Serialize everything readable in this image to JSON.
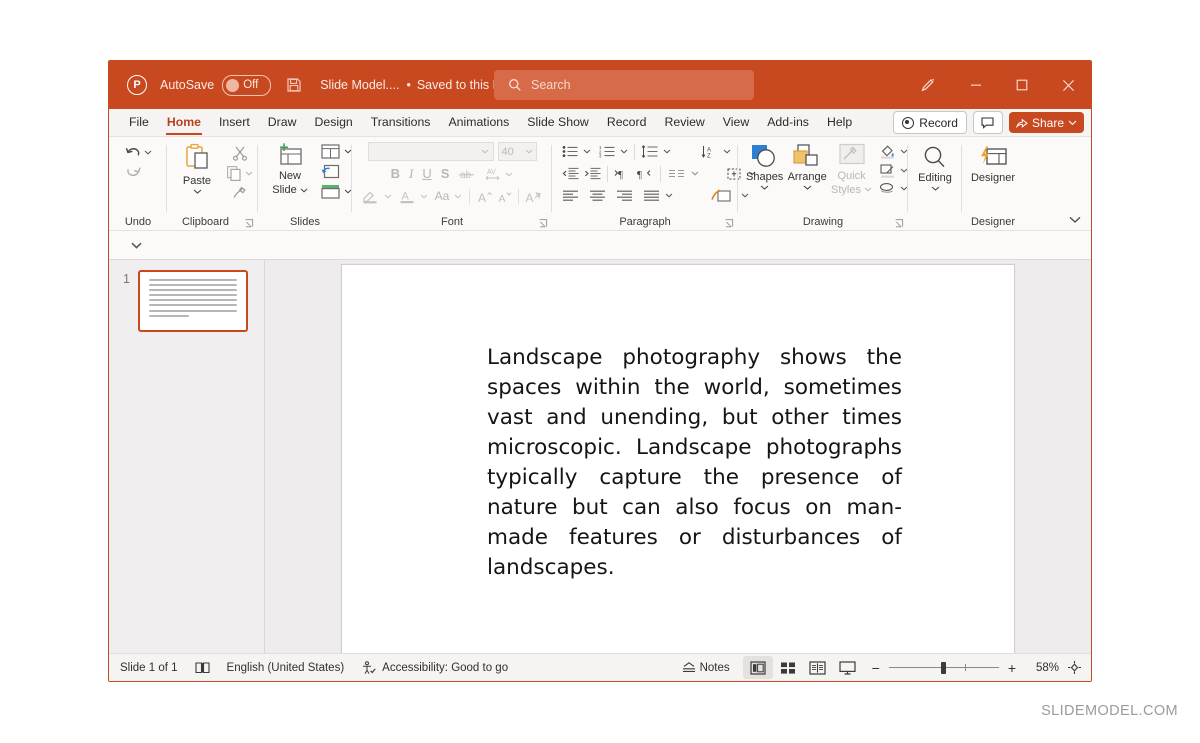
{
  "titlebar": {
    "app_icon": "powerpoint-logo-icon",
    "autosave_label": "AutoSave",
    "autosave_state": "Off",
    "save_icon": "save-icon",
    "document_name": "Slide Model....",
    "separator": "•",
    "save_status": "Saved to this PC",
    "search_placeholder": "Search",
    "search_icon": "search-icon",
    "pen_icon": "pen-icon",
    "minimize_icon": "minimize-icon",
    "maximize_icon": "maximize-icon",
    "close_icon": "close-icon",
    "bg_color": "#c8481f"
  },
  "tabs": [
    {
      "label": "File",
      "active": false
    },
    {
      "label": "Home",
      "active": true
    },
    {
      "label": "Insert",
      "active": false
    },
    {
      "label": "Draw",
      "active": false
    },
    {
      "label": "Design",
      "active": false
    },
    {
      "label": "Transitions",
      "active": false
    },
    {
      "label": "Animations",
      "active": false
    },
    {
      "label": "Slide Show",
      "active": false
    },
    {
      "label": "Record",
      "active": false
    },
    {
      "label": "Review",
      "active": false
    },
    {
      "label": "View",
      "active": false
    },
    {
      "label": "Add-ins",
      "active": false
    },
    {
      "label": "Help",
      "active": false
    }
  ],
  "tab_actions": {
    "record_label": "Record",
    "comment_icon": "comment-icon",
    "share_label": "Share",
    "share_icon": "share-icon",
    "share_chevron": "⌄"
  },
  "ribbon": {
    "groups": [
      {
        "name": "Undo",
        "label": "Undo",
        "items": [
          {
            "name": "undo-button",
            "icon": "undo-arrow-icon",
            "label": ""
          },
          {
            "name": "redo-button",
            "icon": "redo-arrow-icon",
            "label": ""
          }
        ]
      },
      {
        "name": "Clipboard",
        "label": "Clipboard",
        "items": [
          {
            "name": "paste-button",
            "icon": "clipboard-icon",
            "label": "Paste"
          },
          {
            "name": "cut-button",
            "icon": "scissors-icon",
            "label": ""
          },
          {
            "name": "copy-button",
            "icon": "copy-icon",
            "label": ""
          },
          {
            "name": "format-painter-button",
            "icon": "paintbrush-icon",
            "label": ""
          }
        ],
        "dialog_launcher": true
      },
      {
        "name": "Slides",
        "label": "Slides",
        "items": [
          {
            "name": "new-slide-button",
            "icon": "new-slide-icon",
            "label": "New Slide"
          },
          {
            "name": "layout-button",
            "icon": "layout-icon",
            "label": ""
          },
          {
            "name": "reset-button",
            "icon": "reset-icon",
            "label": ""
          },
          {
            "name": "section-button",
            "icon": "section-icon",
            "label": ""
          }
        ]
      },
      {
        "name": "Font",
        "label": "Font",
        "disabled": true,
        "font_name_value": "",
        "font_size_value": "40",
        "items": [
          {
            "name": "bold-button",
            "icon": "bold-icon",
            "label": "B"
          },
          {
            "name": "italic-button",
            "icon": "italic-icon",
            "label": "I"
          },
          {
            "name": "underline-button",
            "icon": "underline-icon",
            "label": "U"
          },
          {
            "name": "shadow-button",
            "icon": "text-shadow-icon",
            "label": "S"
          },
          {
            "name": "strikethrough-button",
            "icon": "strikethrough-icon",
            "label": "ab"
          },
          {
            "name": "character-spacing-button",
            "icon": "character-spacing-icon",
            "label": "AV"
          },
          {
            "name": "text-highlight-button",
            "icon": "highlighter-icon",
            "label": ""
          },
          {
            "name": "font-color-button",
            "icon": "font-color-icon",
            "label": "A"
          },
          {
            "name": "change-case-button",
            "icon": "change-case-icon",
            "label": "Aa"
          },
          {
            "name": "increase-font-size-button",
            "icon": "increase-font-icon",
            "label": "A"
          },
          {
            "name": "decrease-font-size-button",
            "icon": "decrease-font-icon",
            "label": "A"
          },
          {
            "name": "clear-formatting-button",
            "icon": "clear-formatting-icon",
            "label": "A"
          }
        ],
        "dialog_launcher": true
      },
      {
        "name": "Paragraph",
        "label": "Paragraph",
        "items": [
          {
            "name": "bullets-button",
            "icon": "bullet-list-icon"
          },
          {
            "name": "numbering-button",
            "icon": "numbered-list-icon"
          },
          {
            "name": "line-spacing-button",
            "icon": "line-spacing-icon"
          },
          {
            "name": "text-direction-button",
            "icon": "text-direction-icon"
          },
          {
            "name": "decrease-indent-button",
            "icon": "decrease-indent-icon"
          },
          {
            "name": "increase-indent-button",
            "icon": "increase-indent-icon"
          },
          {
            "name": "ltr-button",
            "icon": "left-to-right-icon"
          },
          {
            "name": "rtl-button",
            "icon": "right-to-left-icon"
          },
          {
            "name": "columns-button",
            "icon": "columns-icon"
          },
          {
            "name": "align-text-button",
            "icon": "align-text-icon"
          },
          {
            "name": "align-left-button",
            "icon": "align-left-icon"
          },
          {
            "name": "align-center-button",
            "icon": "align-center-icon"
          },
          {
            "name": "align-right-button",
            "icon": "align-right-icon"
          },
          {
            "name": "justify-button",
            "icon": "justify-icon"
          },
          {
            "name": "convert-smartart-button",
            "icon": "smartart-icon"
          }
        ],
        "dialog_launcher": true
      },
      {
        "name": "Drawing",
        "label": "Drawing",
        "items": [
          {
            "name": "shapes-button",
            "icon": "shapes-icon",
            "label": "Shapes"
          },
          {
            "name": "arrange-button",
            "icon": "arrange-icon",
            "label": "Arrange"
          },
          {
            "name": "quick-styles-button",
            "icon": "quick-styles-icon",
            "label": "Quick Styles",
            "disabled": true
          },
          {
            "name": "shape-fill-button",
            "icon": "fill-bucket-icon",
            "label": ""
          },
          {
            "name": "shape-outline-button",
            "icon": "shape-outline-icon",
            "label": ""
          },
          {
            "name": "shape-effects-button",
            "icon": "shape-effects-icon",
            "label": ""
          }
        ],
        "dialog_launcher": true
      },
      {
        "name": "Editing",
        "label": "",
        "items": [
          {
            "name": "editing-button",
            "icon": "magnifier-icon",
            "label": "Editing"
          }
        ]
      },
      {
        "name": "Designer",
        "label": "Designer",
        "items": [
          {
            "name": "designer-button",
            "icon": "designer-icon",
            "label": "Designer"
          }
        ]
      }
    ],
    "collapse_icon": "ribbon-collapse-chevron-icon"
  },
  "subbar": {
    "dropdown_icon": "chevron-down-icon"
  },
  "thumbnails": {
    "slides": [
      {
        "number": "1",
        "selected": true,
        "text_line_count": 8
      }
    ]
  },
  "slide": {
    "body_text": "Landscape photography shows the spaces within the world, sometimes vast and unending, but other times microscopic. Landscape photographs typically capture the presence of nature but can also focus on man-made features or disturbances of landscapes.",
    "alignment": "justify",
    "lines": [
      "Landscape photography shows the",
      "spaces within the world, sometimes",
      "vast and unending, but other times",
      "microscopic. Landscape photographs",
      "typically capture the presence of",
      "nature but can also focus on man-",
      "made features or disturbances of",
      "landscapes."
    ]
  },
  "status": {
    "slide_counter": "Slide 1 of 1",
    "notes_page_icon": "notes-page-icon",
    "language": "English (United States)",
    "accessibility_icon": "accessibility-icon",
    "accessibility": "Accessibility: Good to go",
    "notes_label": "Notes",
    "notes_icon": "notes-chevron-icon",
    "views": [
      {
        "name": "normal-view-button",
        "icon": "normal-view-icon",
        "selected": true
      },
      {
        "name": "slide-sorter-button",
        "icon": "slide-sorter-icon",
        "selected": false
      },
      {
        "name": "reading-view-button",
        "icon": "reading-view-icon",
        "selected": false
      },
      {
        "name": "slide-show-button",
        "icon": "slide-show-icon",
        "selected": false
      }
    ],
    "zoom_out_icon": "−",
    "zoom_in_icon": "+",
    "zoom_level": "58%",
    "fit_slide_icon": "fit-to-window-icon"
  },
  "watermark": {
    "text": "SLIDEMODEL.COM"
  }
}
